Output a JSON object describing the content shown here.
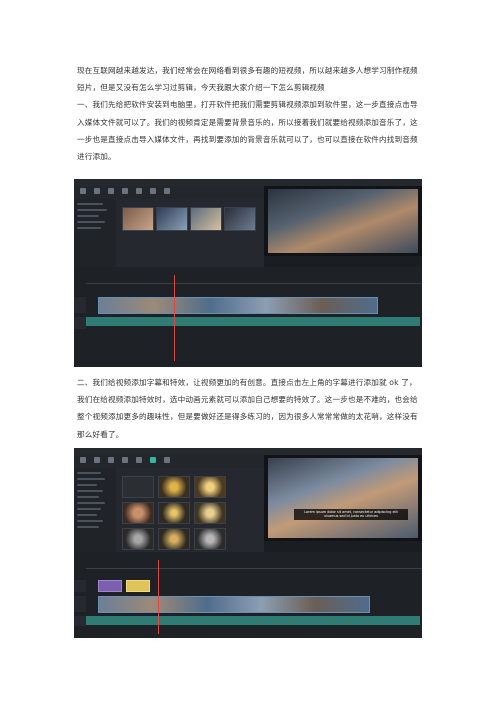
{
  "paragraphs": [
    "现在互联网越来越发达，我们经常会在网络看到很多有趣的短视频，所以越来越多人想学习制作视频短片，但是又没有怎么学习过剪辑，今天我跟大家介绍一下怎么剪辑视频",
    "一、我们先给把软件安装到电脑里，打开软件把我们需要剪辑视频添加到软件里，这一步直接点击导入媒体文件就可以了。我们的视频肯定是需要背景音乐的，所以接着我们就要给视频添加音乐了，这一步也是直接点击导入媒体文件，再找到要添加的背景音乐就可以了，也可以直接在软件内找到音频进行添加。",
    "二、我们给视频添加字幕和特效，让视频更加的有创意。直接点击左上角的字幕进行添加就 ok 了，我们在给视频添加特效时，选中动画元素就可以添加自己想要的特效了。这一步也是不难的，也会给整个视频添加更多的趣味性，但是要做好还是得多练习的，因为很多人常常常做的太花哨，这样没有那么好看了。"
  ],
  "screenshot2_subtitle": [
    "Lorem ipsum dolor sit amet, consectetur adipiscing elit",
    "vivamus sed id justo eu ultrices"
  ],
  "colors": {
    "text": "#333333",
    "app_bg": "#1c1f24",
    "video_clip": "#4f6d8c",
    "audio_clip": "#2e7c73",
    "playhead": "#e04848",
    "accent": "#2fb8a8"
  }
}
